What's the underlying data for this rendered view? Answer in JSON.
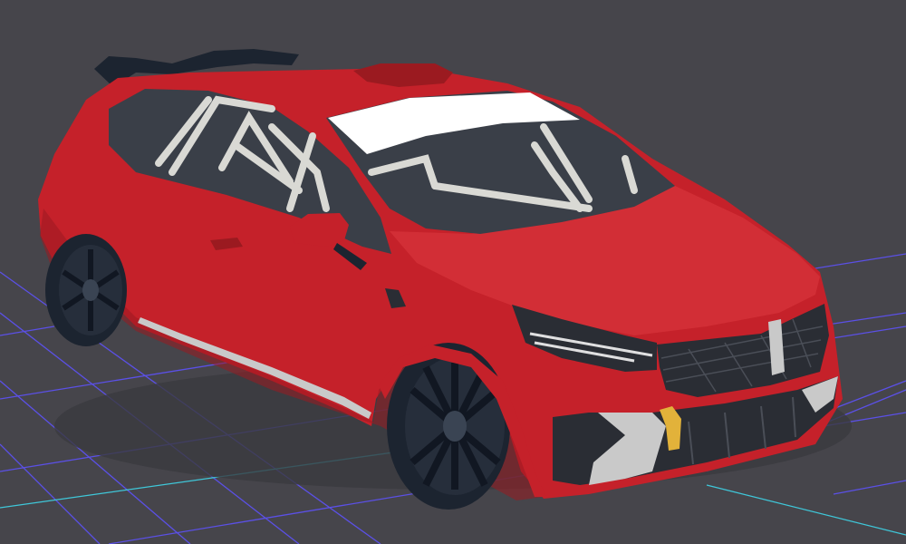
{
  "viewport": {
    "background_color": "#46454b",
    "grid_line_color": "#5b50e6",
    "grid_axis_x_color": "#3fc7d9",
    "grid_axis_z_color": "#3fc7d9"
  },
  "model": {
    "body_color": "#c5212a",
    "body_shade_color": "#9b1a20",
    "body_highlight_color": "#dc3a40",
    "glass_color": "#3a3f48",
    "rollcage_color": "#d9d9d4",
    "wheel_color": "#1c2430",
    "trim_color": "#c9c9c9",
    "windshield_banner_color": "#ffffff",
    "grille_color": "#2a2d34",
    "tow_hook_color": "#e2b23a"
  }
}
